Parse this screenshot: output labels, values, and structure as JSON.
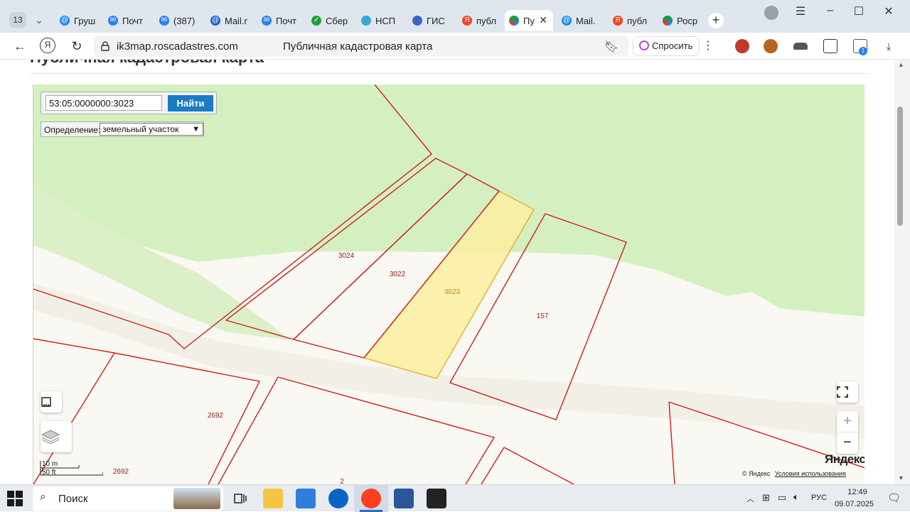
{
  "browser": {
    "tab_count": "13",
    "tabs": [
      {
        "label": "Груш",
        "icon": "mail-at-icon"
      },
      {
        "label": "Почт",
        "icon": "mail-envelope-icon"
      },
      {
        "label": "(387)",
        "icon": "mail-envelope-icon"
      },
      {
        "label": "Mail.r",
        "icon": "mail-ru-icon"
      },
      {
        "label": "Почт",
        "icon": "mail-envelope-icon"
      },
      {
        "label": "Сбер",
        "icon": "sber-icon"
      },
      {
        "label": "НСП",
        "icon": "nspd-icon"
      },
      {
        "label": "ГИС",
        "icon": "gis-icon"
      },
      {
        "label": "публ",
        "icon": "yandex-icon"
      },
      {
        "label": "Пу",
        "icon": "rosreestr-icon",
        "active": true
      },
      {
        "label": "Mail.",
        "icon": "mail-at-icon"
      },
      {
        "label": "публ",
        "icon": "yandex-icon"
      },
      {
        "label": "Роср",
        "icon": "rosreestr-icon"
      }
    ],
    "url_host": "ik3map.roscadastres.com",
    "page_title": "Публичная кадастровая карта",
    "ask_label": "Спросить",
    "ext_badge": "1"
  },
  "page": {
    "heading": "Публичная кадастровая карта"
  },
  "map": {
    "search_value": "53:05:0000000:3023",
    "find_label": "Найти",
    "definition_label": "Определение:",
    "definition_value": "земельный участок",
    "zoom_in": "+",
    "zoom_out": "−",
    "scale_metric": "10 m",
    "scale_imperial": "50 ft",
    "logo": "Яндекс",
    "copyright": "© Яндекс",
    "terms_link": "Условия использования",
    "parcel_labels": [
      "3024",
      "3022",
      "3023",
      "157",
      "2692",
      "2692",
      "2"
    ],
    "colors": {
      "forest": "#d5f0c0",
      "ground": "#f9f8f2",
      "boundary": "#cc1f1f",
      "selected_fill": "#fbeea0",
      "selected_stroke": "#f0b030"
    }
  },
  "taskbar": {
    "search_label": "Поиск",
    "lang": "РУС",
    "time": "12:49",
    "date": "09.07.2025"
  }
}
